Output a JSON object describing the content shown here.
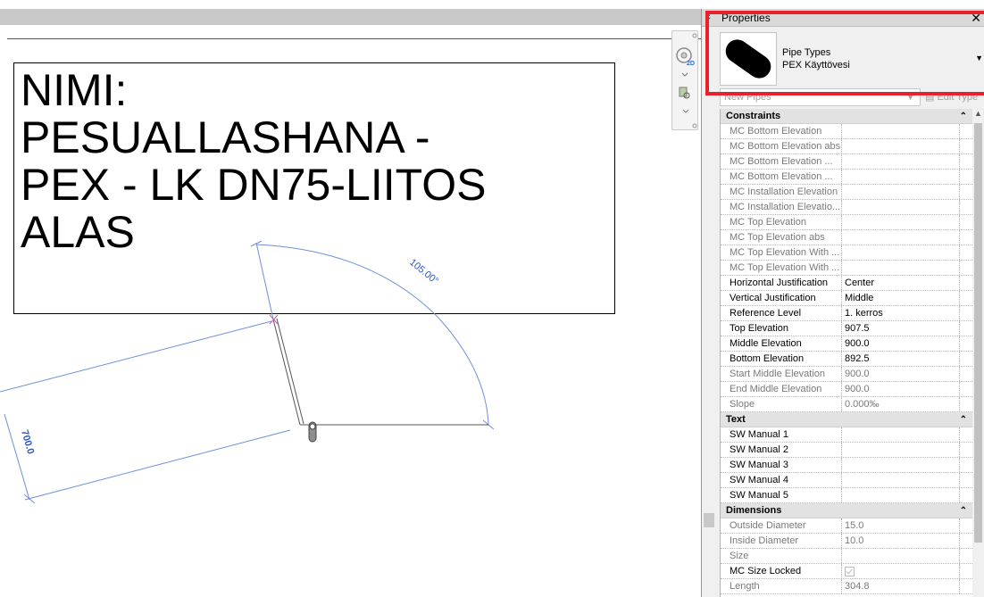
{
  "canvas": {
    "text_note": "NIMI:\nPESUALLASHANA -\nPEX - LK DN75-LIITOS\nALAS",
    "angle_dimension": "105.00°",
    "length_dimension": "700.0"
  },
  "properties": {
    "title": "Properties",
    "close_glyph": "✕",
    "type_family": "Pipe Types",
    "type_name": "PEX Käyttövesi",
    "filter_label": "New Pipes",
    "edit_type_label": "Edit Type",
    "groups": [
      {
        "label": "Constraints",
        "toggle": "⌃",
        "rows": [
          {
            "name": "MC Bottom Elevation",
            "value": "",
            "readonly": true
          },
          {
            "name": "MC Bottom Elevation abs",
            "value": "",
            "readonly": true
          },
          {
            "name": "MC Bottom Elevation ...",
            "value": "",
            "readonly": true
          },
          {
            "name": "MC Bottom Elevation ...",
            "value": "",
            "readonly": true
          },
          {
            "name": "MC Installation Elevation",
            "value": "",
            "readonly": true
          },
          {
            "name": "MC Installation Elevatio...",
            "value": "",
            "readonly": true
          },
          {
            "name": "MC Top Elevation",
            "value": "",
            "readonly": true
          },
          {
            "name": "MC Top Elevation abs",
            "value": "",
            "readonly": true
          },
          {
            "name": "MC Top Elevation With ...",
            "value": "",
            "readonly": true
          },
          {
            "name": "MC Top Elevation With ...",
            "value": "",
            "readonly": true
          },
          {
            "name": "Horizontal Justification",
            "value": "Center",
            "readonly": false
          },
          {
            "name": "Vertical Justification",
            "value": "Middle",
            "readonly": false
          },
          {
            "name": "Reference Level",
            "value": "1. kerros",
            "readonly": false
          },
          {
            "name": "Top Elevation",
            "value": "907.5",
            "readonly": false
          },
          {
            "name": "Middle Elevation",
            "value": "900.0",
            "readonly": false
          },
          {
            "name": "Bottom Elevation",
            "value": "892.5",
            "readonly": false
          },
          {
            "name": "Start Middle Elevation",
            "value": "900.0",
            "readonly": true
          },
          {
            "name": "End Middle Elevation",
            "value": "900.0",
            "readonly": true
          },
          {
            "name": "Slope",
            "value": "0.000‰",
            "readonly": true
          }
        ]
      },
      {
        "label": "Text",
        "toggle": "⌃",
        "rows": [
          {
            "name": "SW Manual 1",
            "value": "",
            "readonly": false
          },
          {
            "name": "SW Manual 2",
            "value": "",
            "readonly": false
          },
          {
            "name": "SW Manual 3",
            "value": "",
            "readonly": false
          },
          {
            "name": "SW Manual 4",
            "value": "",
            "readonly": false
          },
          {
            "name": "SW Manual 5",
            "value": "",
            "readonly": false
          }
        ]
      },
      {
        "label": "Dimensions",
        "toggle": "⌃",
        "rows": [
          {
            "name": "Outside Diameter",
            "value": "15.0",
            "readonly": true
          },
          {
            "name": "Inside Diameter",
            "value": "10.0",
            "readonly": true
          },
          {
            "name": "Size",
            "value": "",
            "readonly": true
          },
          {
            "name": "MC Size Locked",
            "value": "",
            "readonly": false,
            "checkbox": true
          },
          {
            "name": "Length",
            "value": "304.8",
            "readonly": true
          }
        ]
      }
    ]
  }
}
